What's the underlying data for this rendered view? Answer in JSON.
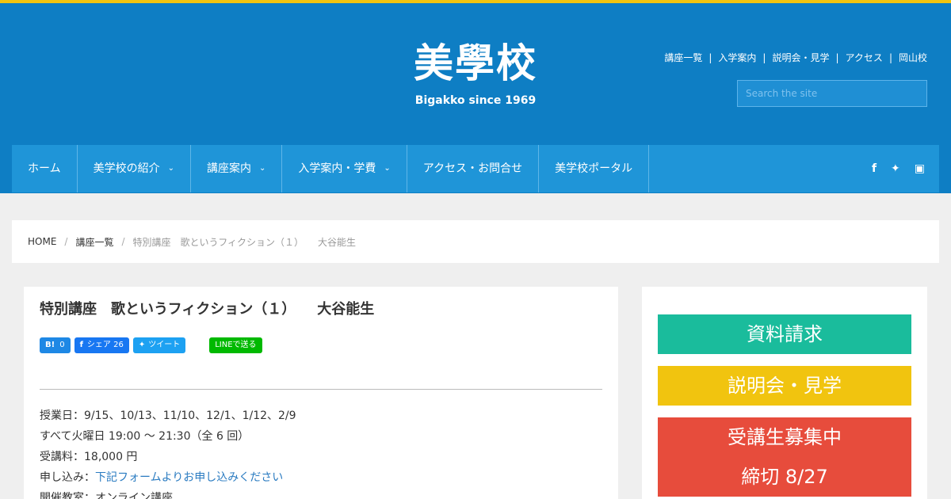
{
  "colors": {
    "header_bg": "#0e7ec4",
    "nav_bg": "#1f95d8",
    "accent_yellow": "#f1c40f",
    "green": "#1abc9c",
    "red": "#e74c3c"
  },
  "logo": {
    "kanji": "美學校",
    "tagline": "Bigakko since 1969"
  },
  "top_links": [
    "講座一覧",
    "入学案内",
    "説明会・見学",
    "アクセス",
    "岡山校"
  ],
  "search": {
    "placeholder": "Search the site"
  },
  "nav": {
    "items": [
      "ホーム",
      "美学校の紹介",
      "講座案内",
      "入学案内・学費",
      "アクセス・お問合せ",
      "美学校ポータル"
    ],
    "social_icons": [
      "facebook-icon",
      "twitter-icon",
      "instagram-icon"
    ]
  },
  "breadcrumb": {
    "home": "HOME",
    "list": "講座一覧",
    "current": "特別講座　歌というフィクション（１）　　大谷能生"
  },
  "article": {
    "title": "特別講座　歌というフィクション（１）　　大谷能生",
    "share": {
      "hatena_count": "0",
      "facebook": "シェア 26",
      "tweet": "ツイート",
      "line": "LINEで送る"
    },
    "lines": {
      "dates": "授業日：9/15、10/13、11/10、12/1、1/12、2/9",
      "schedule": "すべて火曜日 19:00 〜 21:30（全 6 回）",
      "fee": "受講料：18,000 円",
      "apply_label": "申し込み：",
      "apply_link": "下記フォームよりお申し込みください",
      "room": "開催教室：オンライン講座"
    }
  },
  "sidebar": {
    "request": "資料請求",
    "session": "説明会・見学",
    "recruit": "受講生募集中",
    "deadline": "締切 8/27"
  }
}
